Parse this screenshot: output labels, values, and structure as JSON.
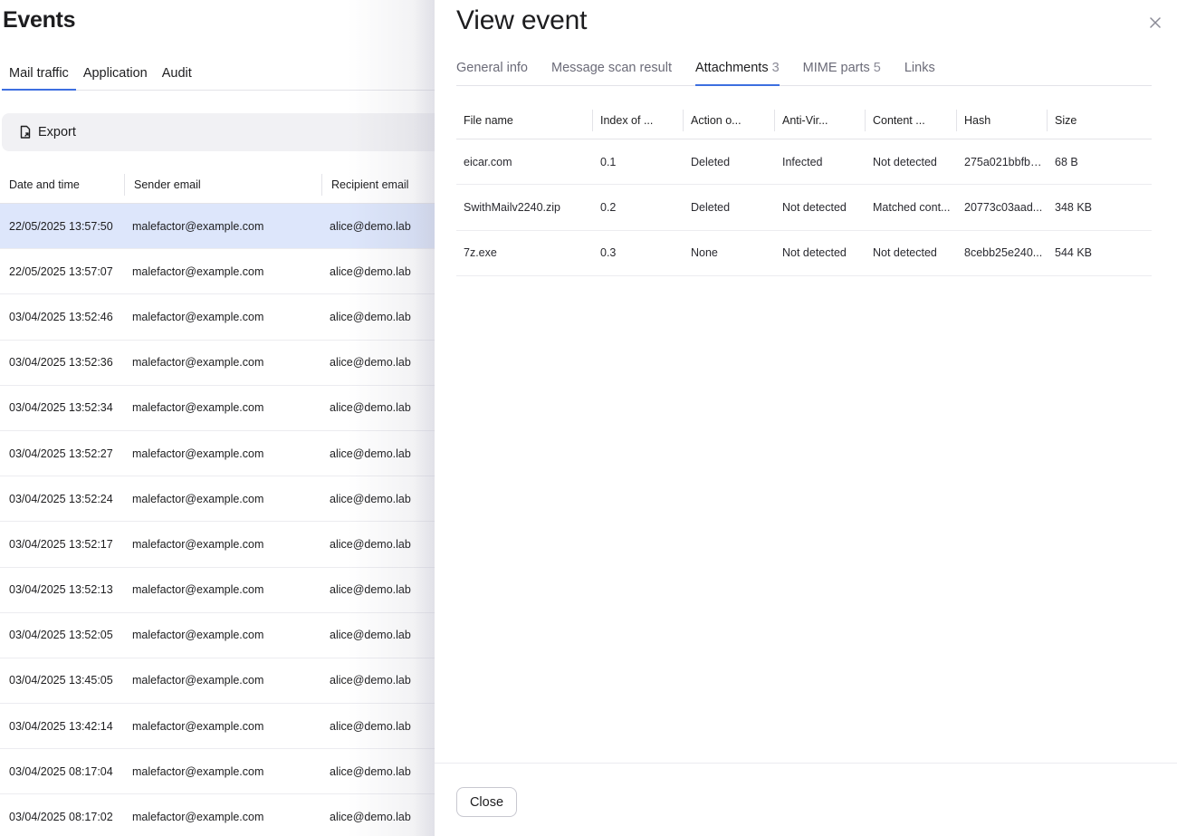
{
  "left": {
    "title": "Events",
    "tabs": [
      "Mail traffic",
      "Application",
      "Audit"
    ],
    "export_label": "Export",
    "columns": [
      "Date and time",
      "Sender email",
      "Recipient email"
    ],
    "rows": [
      [
        "22/05/2025 13:57:50",
        "malefactor@example.com",
        "alice@demo.lab"
      ],
      [
        "22/05/2025 13:57:07",
        "malefactor@example.com",
        "alice@demo.lab"
      ],
      [
        "03/04/2025 13:52:46",
        "malefactor@example.com",
        "alice@demo.lab"
      ],
      [
        "03/04/2025 13:52:36",
        "malefactor@example.com",
        "alice@demo.lab"
      ],
      [
        "03/04/2025 13:52:34",
        "malefactor@example.com",
        "alice@demo.lab"
      ],
      [
        "03/04/2025 13:52:27",
        "malefactor@example.com",
        "alice@demo.lab"
      ],
      [
        "03/04/2025 13:52:24",
        "malefactor@example.com",
        "alice@demo.lab"
      ],
      [
        "03/04/2025 13:52:17",
        "malefactor@example.com",
        "alice@demo.lab"
      ],
      [
        "03/04/2025 13:52:13",
        "malefactor@example.com",
        "alice@demo.lab"
      ],
      [
        "03/04/2025 13:52:05",
        "malefactor@example.com",
        "alice@demo.lab"
      ],
      [
        "03/04/2025 13:45:05",
        "malefactor@example.com",
        "alice@demo.lab"
      ],
      [
        "03/04/2025 13:42:14",
        "malefactor@example.com",
        "alice@demo.lab"
      ],
      [
        "03/04/2025 08:17:04",
        "malefactor@example.com",
        "alice@demo.lab"
      ],
      [
        "03/04/2025 08:17:02",
        "malefactor@example.com",
        "alice@demo.lab"
      ]
    ]
  },
  "drawer": {
    "title": "View event",
    "tabs": [
      {
        "label": "General info",
        "count": ""
      },
      {
        "label": "Message scan result",
        "count": ""
      },
      {
        "label": "Attachments",
        "count": "3"
      },
      {
        "label": "MIME parts",
        "count": "5"
      },
      {
        "label": "Links",
        "count": ""
      }
    ],
    "columns": [
      "File name",
      "Index of ...",
      "Action o...",
      "Anti-Vir...",
      "Content ...",
      "Hash",
      "Size"
    ],
    "rows": [
      [
        "eicar.com",
        "0.1",
        "Deleted",
        "Infected",
        "Not detected",
        "275a021bbfb6...",
        "68 B"
      ],
      [
        "SwithMailv2240.zip",
        "0.2",
        "Deleted",
        "Not detected",
        "Matched cont...",
        "20773c03aad...",
        "348 KB"
      ],
      [
        "7z.exe",
        "0.3",
        "None",
        "Not detected",
        "Not detected",
        "8cebb25e240...",
        "544 KB"
      ]
    ],
    "close_label": "Close"
  },
  "colors": {
    "accent": "#3d6fe0",
    "selected_row": "#dde6fb"
  },
  "icons": {
    "export": "file-export-icon",
    "close": "close-icon"
  }
}
